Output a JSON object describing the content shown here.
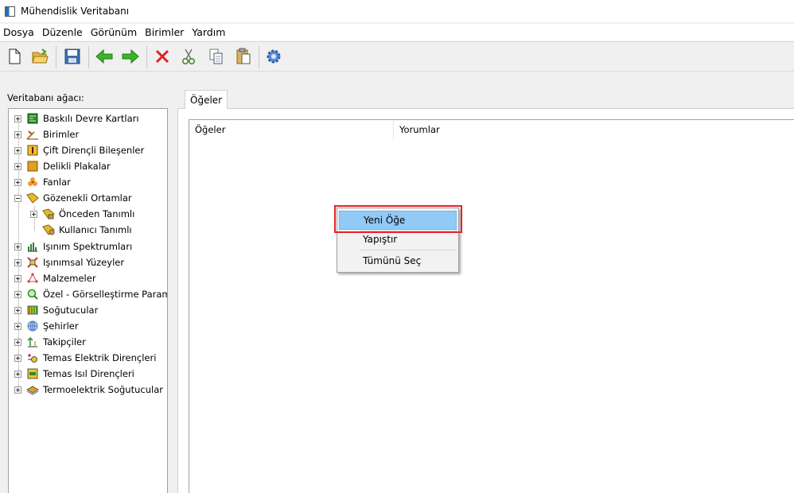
{
  "window": {
    "title": "Mühendislik Veritabanı"
  },
  "menu": [
    "Dosya",
    "Düzenle",
    "Görünüm",
    "Birimler",
    "Yardım"
  ],
  "toolbar": {
    "buttons": [
      "new-file",
      "open-folder",
      "save",
      "back",
      "forward",
      "delete",
      "cut",
      "copy",
      "paste",
      "settings"
    ]
  },
  "left_panel": {
    "label": "Veritabanı ağacı:",
    "tree": [
      {
        "label": "Baskılı Devre Kartları",
        "icon": "pcb-icon",
        "color": "#2e8b2e"
      },
      {
        "label": "Birimler",
        "icon": "ruler-icon",
        "color": "#c0872a"
      },
      {
        "label": "Çift Dirençli Bileşenler",
        "icon": "resistor-icon",
        "color": "#d9a520"
      },
      {
        "label": "Delikli Plakalar",
        "icon": "perforated-plate-icon",
        "color": "#e0a020"
      },
      {
        "label": "Fanlar",
        "icon": "fan-icon",
        "color": "#f08a20"
      },
      {
        "label": "Gözenekli Ortamlar",
        "icon": "porous-media-icon",
        "color": "#e0b030"
      },
      {
        "label": "Önceden Tanımlı",
        "icon": "porous-predefined-icon",
        "color": "#e0b030"
      },
      {
        "label": "Kullanıcı Tanımlı",
        "icon": "porous-user-icon",
        "color": "#e0b030"
      },
      {
        "label": "Işınım Spektrumları",
        "icon": "spectrum-icon",
        "color": "#2e7d32"
      },
      {
        "label": "Işınımsal Yüzeyler",
        "icon": "radiative-surface-icon",
        "color": "#d23030"
      },
      {
        "label": "Malzemeler",
        "icon": "materials-icon",
        "color": "#d04040"
      },
      {
        "label": "Özel - Görselleştirme Parametreleri",
        "icon": "visualization-icon",
        "color": "#2e8b2e"
      },
      {
        "label": "Soğutucular",
        "icon": "heatsink-icon",
        "color": "#2e8b2e"
      },
      {
        "label": "Şehirler",
        "icon": "globe-icon",
        "color": "#4a7bbf"
      },
      {
        "label": "Takipçiler",
        "icon": "trackers-icon",
        "color": "#e0a020"
      },
      {
        "label": "Temas Elektrik Dirençleri",
        "icon": "electric-resistance-icon",
        "color": "#d23030"
      },
      {
        "label": "Temas Isıl Dirençleri",
        "icon": "thermal-resistance-icon",
        "color": "#2e8b2e"
      },
      {
        "label": "Termoelektrik Soğutucular",
        "icon": "thermoelectric-cooler-icon",
        "color": "#c08020"
      }
    ]
  },
  "right_panel": {
    "tab": "Öğeler",
    "columns": [
      "Öğeler",
      "Yorumlar"
    ]
  },
  "context_menu": {
    "items": [
      "Yeni Öğe",
      "Yapıştır",
      "Tümünü Seç"
    ]
  }
}
